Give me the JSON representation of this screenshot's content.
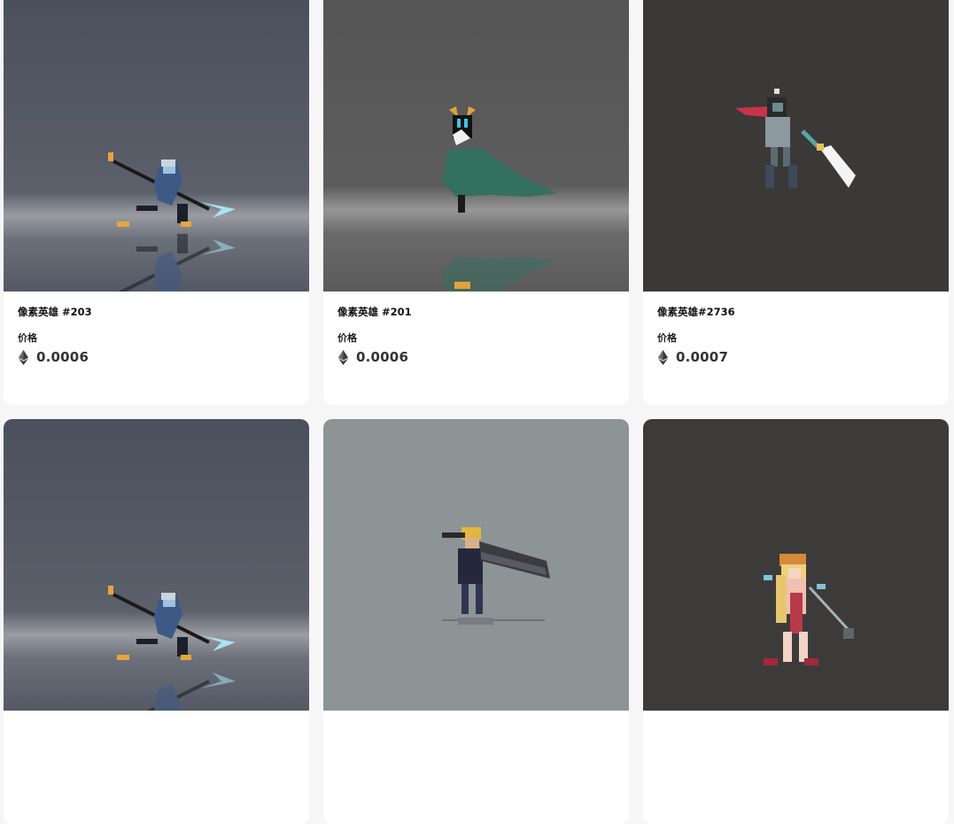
{
  "cards": [
    {
      "name": "像素英雄 #203",
      "price_label": "价格",
      "price": "0.0006",
      "currency_icon": "ethereum-icon",
      "background": "#4d5360",
      "artwork": "pixel-spear-warrior"
    },
    {
      "name": "像素英雄 #201",
      "price_label": "价格",
      "price": "0.0006",
      "currency_icon": "ethereum-icon",
      "background": "#575757",
      "artwork": "pixel-caped-knight"
    },
    {
      "name": "像素英雄#2736",
      "price_label": "价格",
      "price": "0.0007",
      "currency_icon": "ethereum-icon",
      "background": "#3a3938",
      "artwork": "pixel-sword-ninja"
    },
    {
      "name": "",
      "price_label": "",
      "price": "",
      "currency_icon": "ethereum-icon",
      "background": "#4d5360",
      "artwork": "pixel-spear-warrior"
    },
    {
      "name": "",
      "price_label": "",
      "price": "",
      "currency_icon": "ethereum-icon",
      "background": "#8c9496",
      "artwork": "pixel-greatsword-fighter"
    },
    {
      "name": "",
      "price_label": "",
      "price": "",
      "currency_icon": "ethereum-icon",
      "background": "#3c3b3a",
      "artwork": "pixel-blonde-mage"
    }
  ]
}
